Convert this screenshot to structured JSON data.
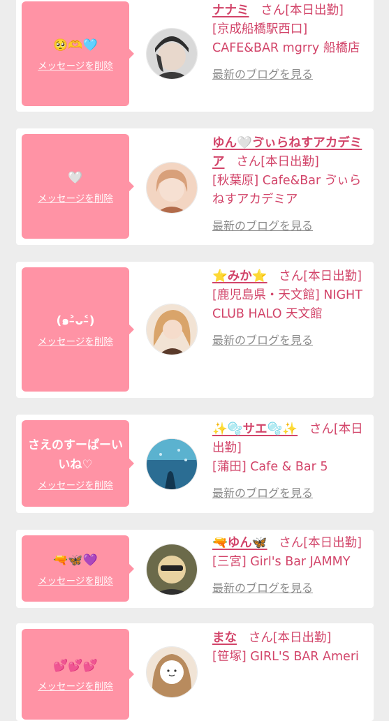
{
  "delete_label": "メッセージを削除",
  "blog_label": "最新のブログを見る",
  "suffix": "さん[本日出勤]",
  "cards": [
    {
      "message": "🥺🫶🩵",
      "name": "ナナミ",
      "shop": "[京成船橋駅西口] CAFE&BAR mgrry 船橋店",
      "avatar_colors": [
        "#3a3a3a",
        "#bdbdbd",
        "#e8d8cc"
      ]
    },
    {
      "message": "🤍",
      "name": "ゆん🤍ゔぃらねすアカデミア",
      "shop": "[秋葉原] Cafe&Bar ゔぃらねすアカデミア",
      "avatar_colors": [
        "#d8a07a",
        "#f3d5c2",
        "#b26b4a"
      ]
    },
    {
      "message": "(๑˃̵ᴗ˂̵)",
      "name": "⭐みか⭐",
      "shop": "[鹿児島県・天文館] NIGHT CLUB HALO 天文館",
      "avatar_colors": [
        "#d9a46a",
        "#f2e3d4",
        "#5a3a2a"
      ]
    },
    {
      "message": "さえのすーぱーいいね♡",
      "name": "✨🫧サエ🫧✨",
      "shop": "[蒲田] Cafe & Bar 5",
      "avatar_colors": [
        "#2b6d93",
        "#5bb2cf",
        "#12364f"
      ]
    },
    {
      "message": "🔫🦋💜",
      "name": "🔫ゆん🦋",
      "shop": "[三宮] Girl's Bar JAMMY",
      "avatar_colors": [
        "#6b6a4a",
        "#e8d2a0",
        "#222222"
      ]
    },
    {
      "message": "💕💕💕",
      "name": "まな",
      "shop": "[笹塚] GIRL'S BAR Ameri",
      "avatar_colors": [
        "#b88b5e",
        "#f1e4d6",
        "#ffffff"
      ]
    }
  ]
}
